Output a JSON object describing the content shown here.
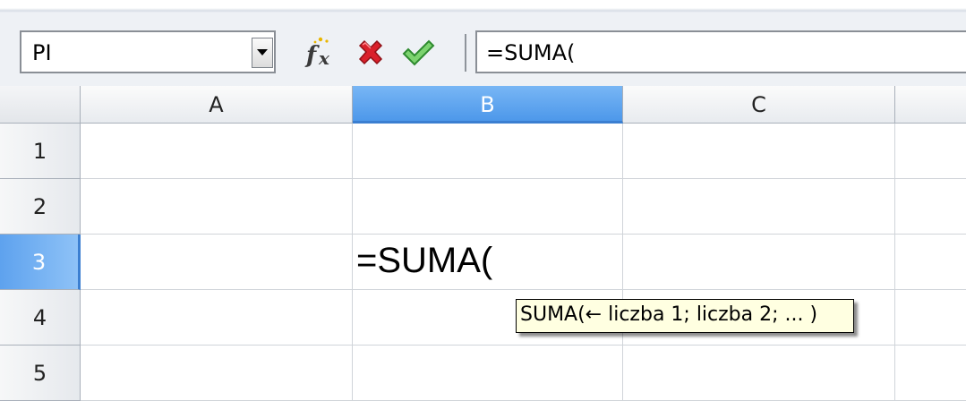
{
  "formula_bar": {
    "name_box": "PI",
    "input_value": "=SUMA("
  },
  "columns": [
    "A",
    "B",
    "C"
  ],
  "rows": [
    "1",
    "2",
    "3",
    "4",
    "5"
  ],
  "active_cell": {
    "column": "B",
    "row": "3",
    "content": "=SUMA("
  },
  "tooltip": {
    "text": "SUMA(← liczba 1; liczba 2; ... )"
  },
  "icons": {
    "function_wizard": "fx-icon",
    "cancel": "cancel-x-icon",
    "accept": "checkmark-icon",
    "dropdown": "chevron-down-icon"
  },
  "colors": {
    "selection_header": "#4d98ea",
    "tooltip_bg": "#ffffe1",
    "cancel_red": "#d9202a",
    "accept_green": "#2fa432"
  }
}
